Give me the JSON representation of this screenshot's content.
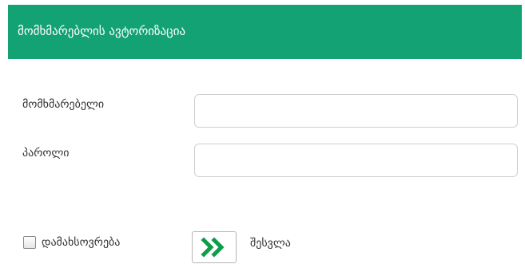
{
  "header": {
    "title": "მომხმარებლის ავტორიზაცია"
  },
  "form": {
    "username_label": "მომხმარებელი",
    "username_value": "",
    "password_label": "პაროლი",
    "password_value": "",
    "remember_label": "დამახსოვრება",
    "remember_checked": false,
    "submit_label": "შესვლა"
  },
  "colors": {
    "header_bg": "#13a273",
    "accent_icon": "#0e9c4a"
  },
  "icons": {
    "submit": "double-chevron-right-icon"
  }
}
